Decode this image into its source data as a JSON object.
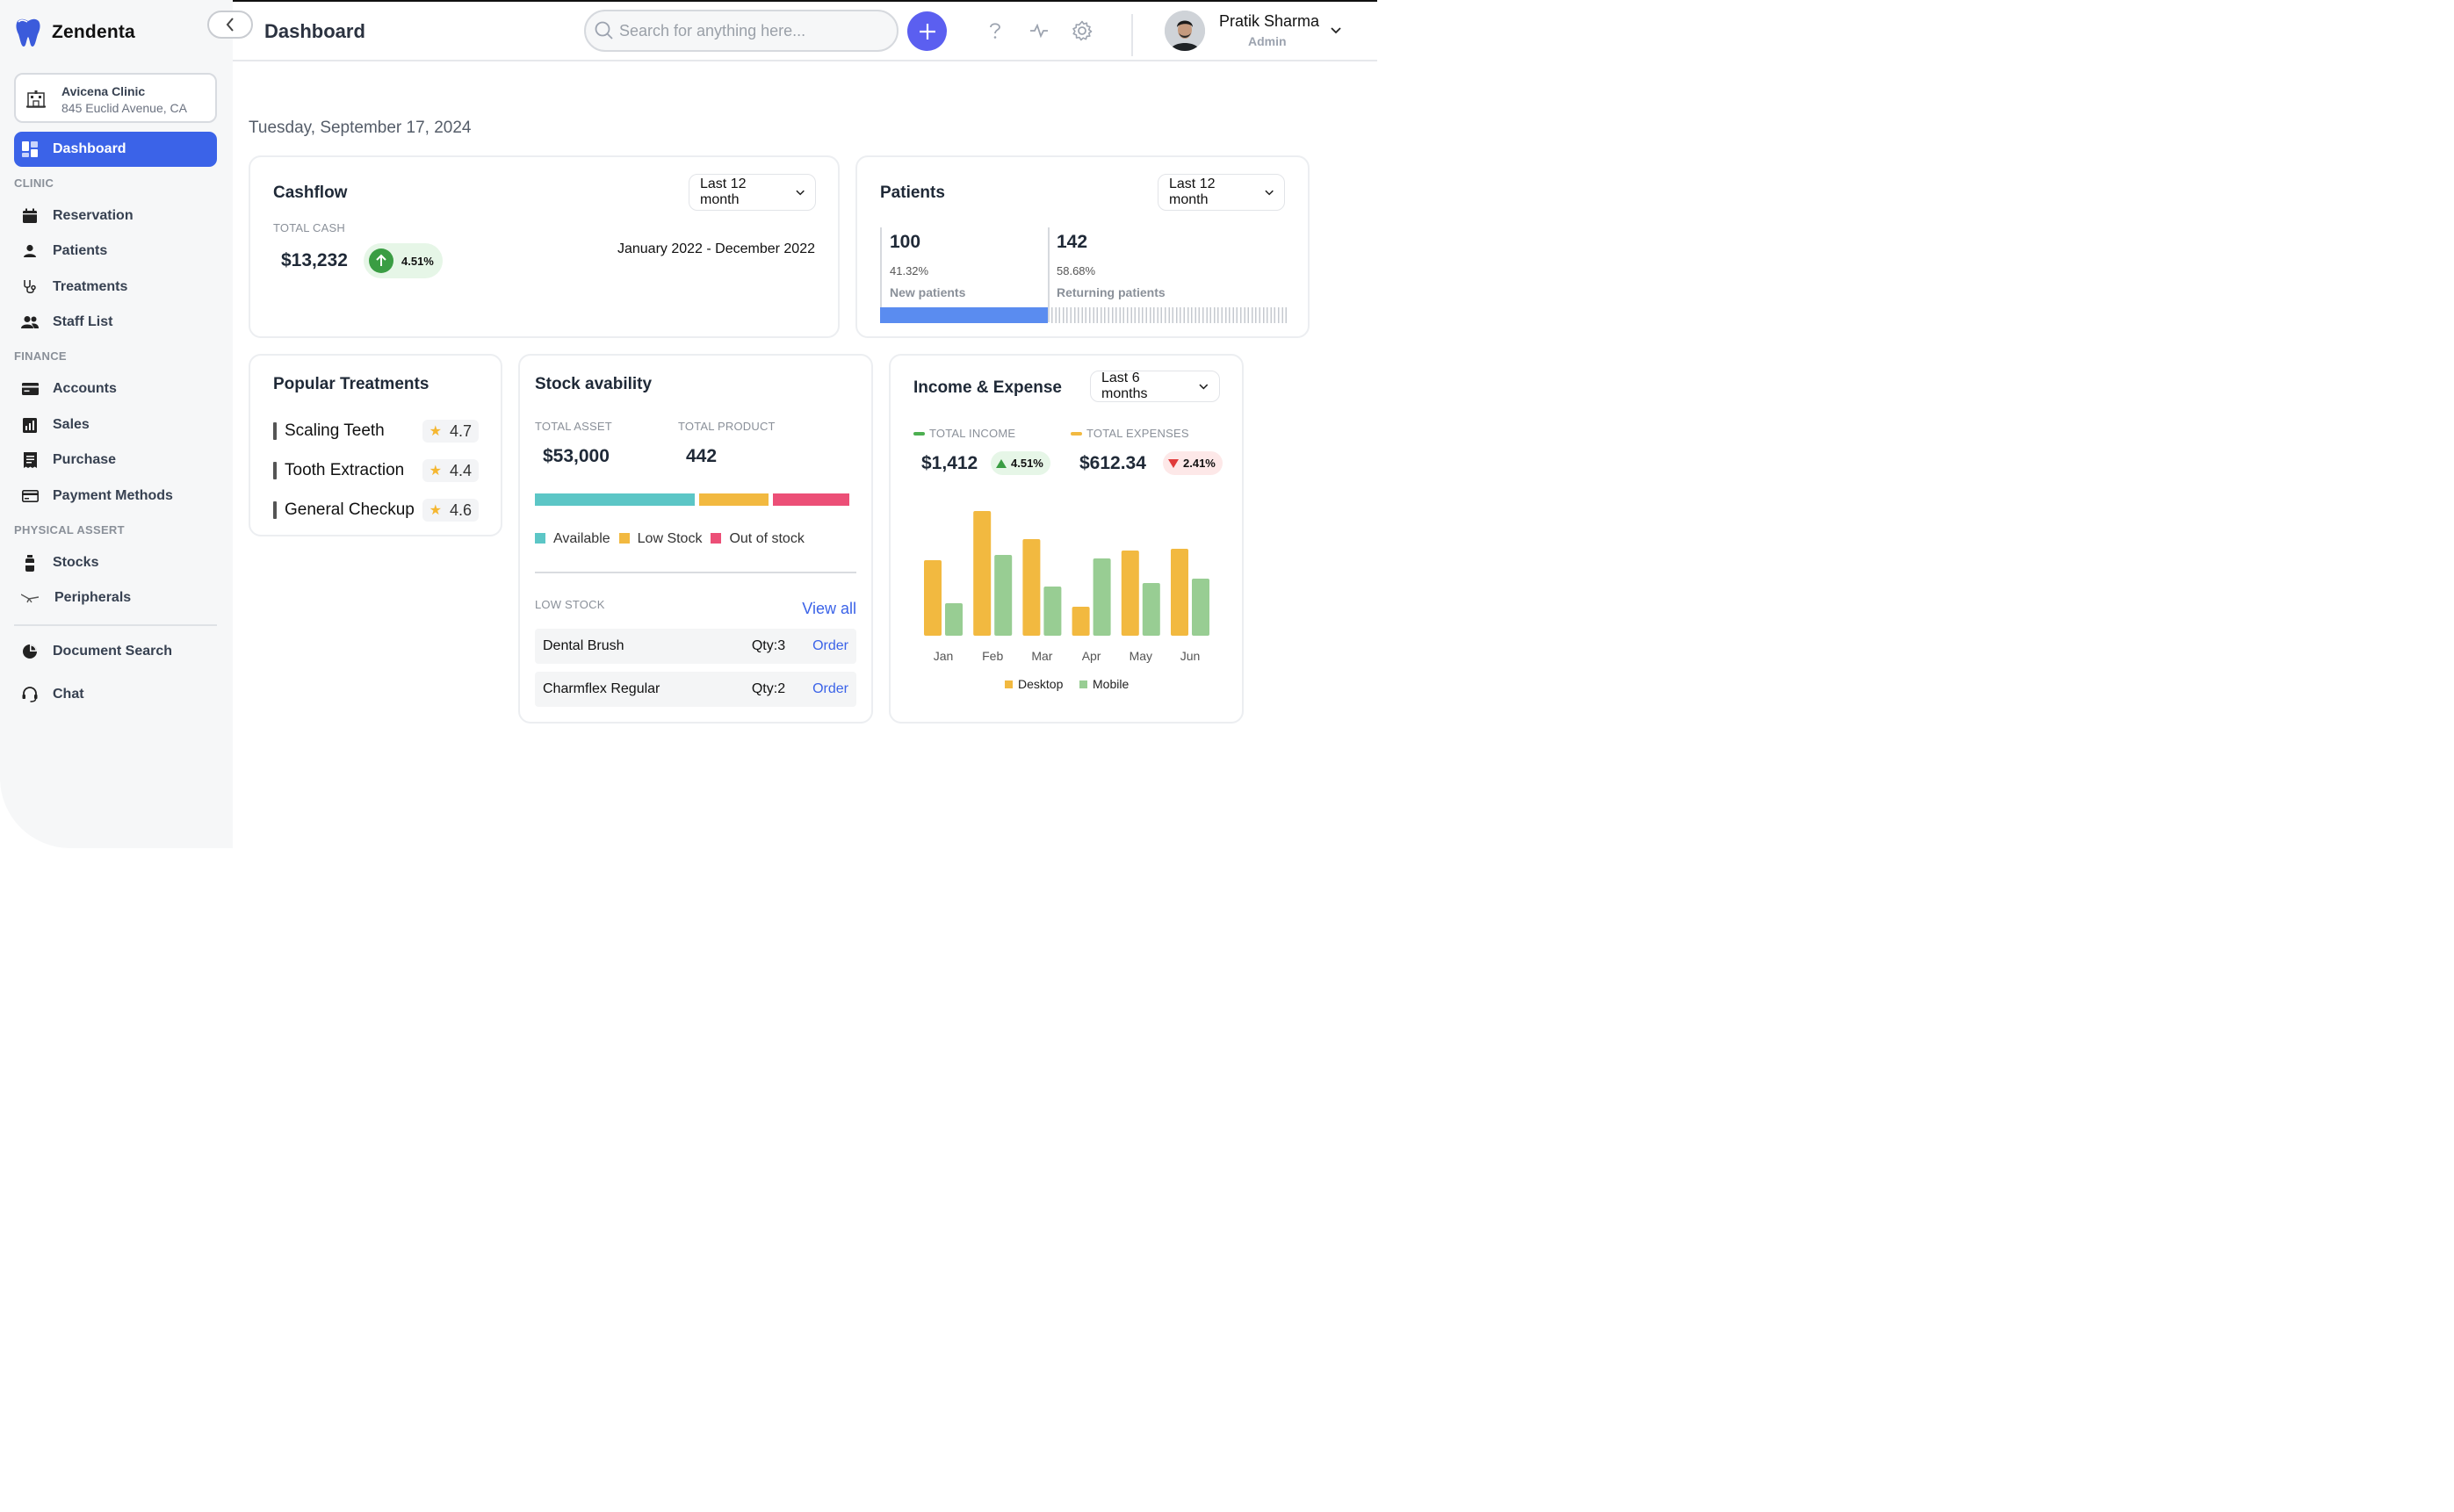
{
  "app": {
    "name": "Zendenta"
  },
  "clinic": {
    "name": "Avicena Clinic",
    "address": "845 Euclid Avenue, CA"
  },
  "sidebar": {
    "active": {
      "label": "Dashboard",
      "icon": "dashboard-icon"
    },
    "sections": [
      {
        "label": "CLINIC",
        "items": [
          {
            "label": "Reservation",
            "icon": "calendar-icon"
          },
          {
            "label": "Patients",
            "icon": "person-icon"
          },
          {
            "label": "Treatments",
            "icon": "stethoscope-icon"
          },
          {
            "label": "Staff List",
            "icon": "group-icon"
          }
        ]
      },
      {
        "label": "FINANCE",
        "items": [
          {
            "label": "Accounts",
            "icon": "wallet-icon"
          },
          {
            "label": "Sales",
            "icon": "bar-chart-icon"
          },
          {
            "label": "Purchase",
            "icon": "receipt-icon"
          },
          {
            "label": "Payment Methods",
            "icon": "credit-card-icon"
          }
        ]
      },
      {
        "label": "PHYSICAL ASSERT",
        "items": [
          {
            "label": "Stocks",
            "icon": "bottle-icon"
          },
          {
            "label": "Peripherals",
            "icon": "dental-chair-icon"
          }
        ]
      }
    ],
    "bottom": [
      {
        "label": "Document Search",
        "icon": "pie-chart-icon"
      },
      {
        "label": "Chat",
        "icon": "headset-icon"
      }
    ]
  },
  "header": {
    "title": "Dashboard",
    "search_placeholder": "Search for anything here...",
    "user": {
      "name": "Pratik Sharma",
      "role": "Admin"
    }
  },
  "date": "Tuesday, September 17, 2024",
  "cashflow": {
    "title": "Cashflow",
    "period": "Last 12 month",
    "total_label": "TOTAL CASH",
    "total": "$13,232",
    "change": "4.51%",
    "range": "January 2022 - December 2022"
  },
  "patients": {
    "title": "Patients",
    "period": "Last 12 month",
    "new": {
      "value": "100",
      "percent": "41.32%",
      "label": "New patients",
      "share": 0.4132
    },
    "returning": {
      "value": "142",
      "percent": "58.68%",
      "label": "Returning patients",
      "share": 0.5868
    }
  },
  "treatments": {
    "title": "Popular Treatments",
    "items": [
      {
        "name": "Scaling Teeth",
        "rating": "4.7"
      },
      {
        "name": "Tooth Extraction",
        "rating": "4.4"
      },
      {
        "name": "General Checkup",
        "rating": "4.6"
      }
    ]
  },
  "stock": {
    "title": "Stock avability",
    "asset_label": "TOTAL ASSET",
    "asset": "$53,000",
    "product_label": "TOTAL PRODUCT",
    "product": "442",
    "segments": [
      {
        "label": "Available",
        "color": "#5cc6c6",
        "share": 0.51
      },
      {
        "label": "Low Stock",
        "color": "#f2b940",
        "share": 0.22
      },
      {
        "label": "Out of stock",
        "color": "#ec4f77",
        "share": 0.245
      }
    ],
    "low_label": "LOW STOCK",
    "view_all": "View all",
    "low_items": [
      {
        "name": "Dental Brush",
        "qty": "Qty:3",
        "action": "Order"
      },
      {
        "name": "Charmflex Regular",
        "qty": "Qty:2",
        "action": "Order"
      }
    ]
  },
  "income": {
    "title": "Income & Expense",
    "period": "Last 6 months",
    "income_label": "TOTAL INCOME",
    "income": "$1,412",
    "income_change": "4.51%",
    "expense_label": "TOTAL EXPENSES",
    "expense": "$612.34",
    "expense_change": "2.41%",
    "colors": {
      "income": "#4caf50",
      "expense": "#f2b940",
      "up": "#3a9d43",
      "down": "#e03a3a"
    }
  },
  "chart_data": {
    "type": "bar",
    "categories": [
      "Jan",
      "Feb",
      "Mar",
      "Apr",
      "May",
      "Jun"
    ],
    "series": [
      {
        "name": "Desktop",
        "color": "#f2b940",
        "values": [
          86,
          142,
          110,
          33,
          97,
          99
        ]
      },
      {
        "name": "Mobile",
        "color": "#98cd93",
        "values": [
          37,
          92,
          56,
          88,
          60,
          65
        ]
      }
    ],
    "ylim": [
      0,
      150
    ],
    "grid": false,
    "legend": "bottom"
  }
}
